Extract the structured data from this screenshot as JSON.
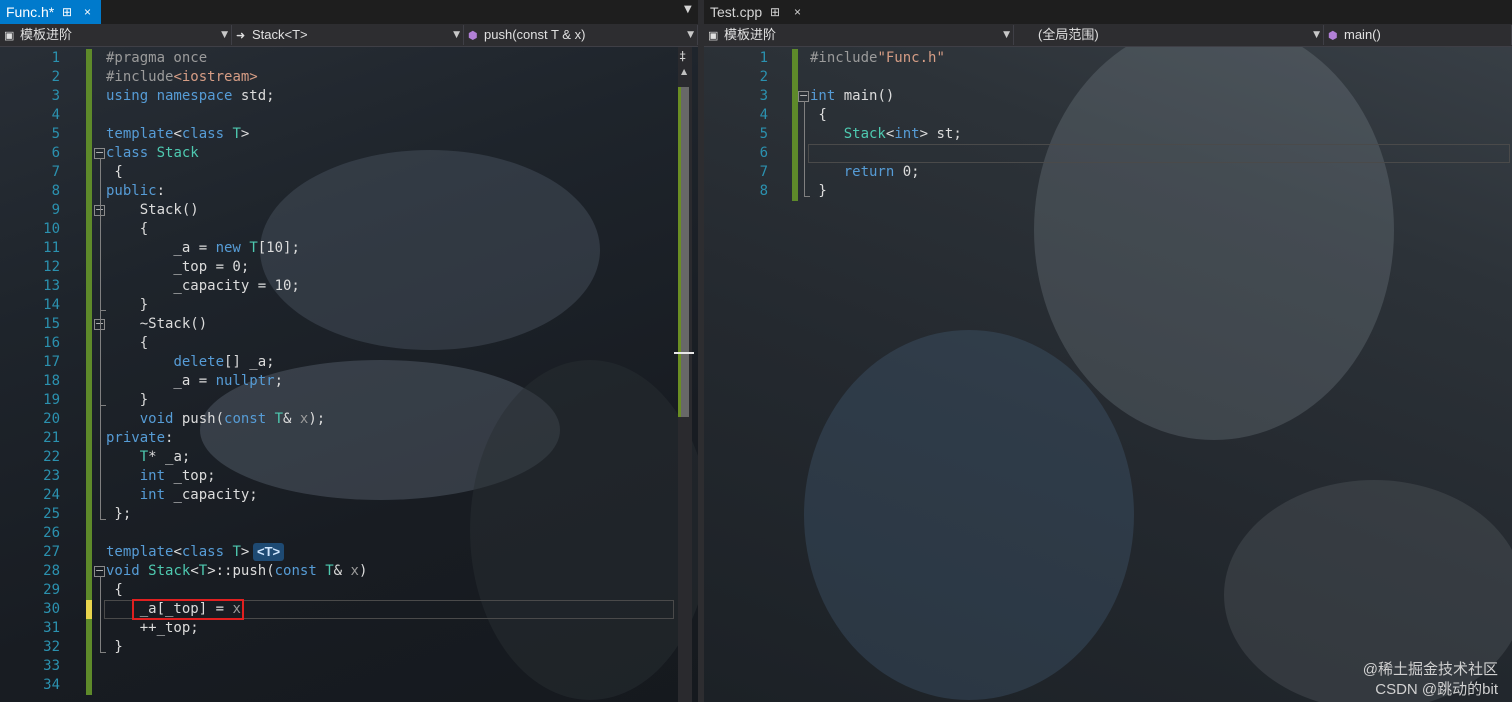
{
  "left": {
    "tab": {
      "title": "Func.h*",
      "pin": "⊞",
      "close": "×"
    },
    "nav": {
      "project": "模板进阶",
      "scope": "Stack<T>",
      "member": "push(const T & x)"
    },
    "lines": [
      {
        "n": "1",
        "html": "<span class='pp'>#pragma once</span>"
      },
      {
        "n": "2",
        "html": "<span class='pp'>#include</span><span class='st'>&lt;iostream&gt;</span>"
      },
      {
        "n": "3",
        "html": "<span class='kw'>using namespace</span> <span class='id'>std</span>;"
      },
      {
        "n": "4",
        "html": ""
      },
      {
        "n": "5",
        "html": "<span class='kw'>template</span>&lt;<span class='kw'>class</span> <span class='ty'>T</span>&gt;"
      },
      {
        "n": "6",
        "html": "<span class='kw'>class</span> <span class='ty'>Stack</span>"
      },
      {
        "n": "7",
        "html": " {"
      },
      {
        "n": "8",
        "html": "<span class='kw'>public</span>:"
      },
      {
        "n": "9",
        "html": "    Stack()"
      },
      {
        "n": "10",
        "html": "    {"
      },
      {
        "n": "11",
        "html": "        _a = <span class='kw'>new</span> <span class='ty'>T</span>[10];"
      },
      {
        "n": "12",
        "html": "        _top = 0;"
      },
      {
        "n": "13",
        "html": "        _capacity = 10;"
      },
      {
        "n": "14",
        "html": "    }"
      },
      {
        "n": "15",
        "html": "    ~Stack()"
      },
      {
        "n": "16",
        "html": "    {"
      },
      {
        "n": "17",
        "html": "        <span class='kw'>delete</span>[] _a;"
      },
      {
        "n": "18",
        "html": "        _a = <span class='kw'>nullptr</span>;"
      },
      {
        "n": "19",
        "html": "    }"
      },
      {
        "n": "20",
        "html": "    <span class='kw'>void</span> push(<span class='kw'>const</span> <span class='ty'>T</span>&amp; <span class='pp'>x</span>);"
      },
      {
        "n": "21",
        "html": "<span class='kw'>private</span>:"
      },
      {
        "n": "22",
        "html": "    <span class='ty'>T</span>* _a;"
      },
      {
        "n": "23",
        "html": "    <span class='kw'>int</span> _top;"
      },
      {
        "n": "24",
        "html": "    <span class='kw'>int</span> _capacity;"
      },
      {
        "n": "25",
        "html": " };"
      },
      {
        "n": "26",
        "html": ""
      },
      {
        "n": "27",
        "html": "<span class='kw'>template</span>&lt;<span class='kw'>class</span> <span class='ty'>T</span>&gt;"
      },
      {
        "n": "28",
        "html": "<span class='kw'>void</span> <span class='ty'>Stack</span>&lt;<span class='ty'>T</span>&gt;::push(<span class='kw'>const</span> <span class='ty'>T</span>&amp; <span class='pp'>x</span>)"
      },
      {
        "n": "29",
        "html": " {"
      },
      {
        "n": "30",
        "html": "    _a[_top] = <span class='pp'>x</span>"
      },
      {
        "n": "31",
        "html": "    ++_top;"
      },
      {
        "n": "32",
        "html": " }"
      },
      {
        "n": "33",
        "html": ""
      },
      {
        "n": "34",
        "html": ""
      }
    ],
    "hint": "<T>"
  },
  "right": {
    "tab": {
      "title": "Test.cpp",
      "pin": "⊞",
      "close": "×"
    },
    "nav": {
      "project": "模板进阶",
      "scope": "(全局范围)",
      "member": "main()"
    },
    "lines": [
      {
        "n": "1",
        "html": "<span class='pp'>#include</span><span class='st'>\"Func.h\"</span>"
      },
      {
        "n": "2",
        "html": ""
      },
      {
        "n": "3",
        "html": "<span class='kw'>int</span> main()"
      },
      {
        "n": "4",
        "html": " {"
      },
      {
        "n": "5",
        "html": "    <span class='ty'>Stack</span>&lt;<span class='kw'>int</span>&gt; st;"
      },
      {
        "n": "6",
        "html": ""
      },
      {
        "n": "7",
        "html": "    <span class='kw'>return</span> 0;"
      },
      {
        "n": "8",
        "html": " }"
      }
    ]
  },
  "watermark": {
    "line1": "@稀土掘金技术社区",
    "line2": "CSDN @跳动的bit"
  },
  "colors": {
    "accent": "#007acc",
    "keyword": "#569cd6",
    "type": "#4ec9b0",
    "string": "#d69d85",
    "preproc": "#9b9b9b",
    "linenum": "#2b91af",
    "changebar": "#5e8a2a",
    "highlight": "#e02020"
  },
  "icons": {
    "project": "project-icon",
    "scope": "class-icon",
    "member": "method-icon",
    "dropdown": "chevron-down-icon",
    "split": "split-editor-icon"
  }
}
